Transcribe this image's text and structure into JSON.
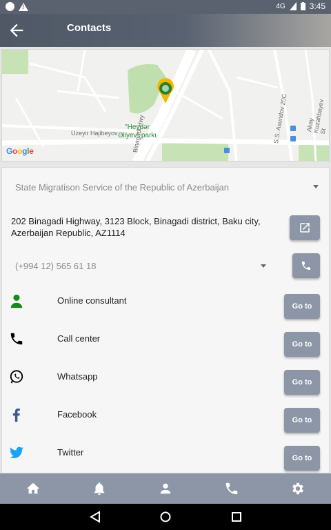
{
  "status_bar": {
    "signal": "4G",
    "time": "3:45"
  },
  "app_bar": {
    "title": "Contacts"
  },
  "map": {
    "park_label_line1": "\"Heydər",
    "park_label_line2": "Əliyev\" parkı",
    "street_1": "Uzeyir Hajibeyov",
    "street_2": "Binagadi Hwy",
    "street_3": "S.S. Axundov 20C",
    "street_4": "Akay Kuzahbayev St",
    "logo": "Google"
  },
  "organization": {
    "selected": "State Migratison Service of the Republic of Azerbaijan"
  },
  "address": {
    "text": "202 Binagadi Highway, 3123 Block, Binagadi district, Baku city, Azerbaijan Republic, AZ1114"
  },
  "phone": {
    "selected": "(+994 12) 565 61 18"
  },
  "channels": [
    {
      "label": "Online consultant",
      "button": "Go to",
      "icon": "person-icon",
      "color": "#1a8a1a"
    },
    {
      "label": "Call center",
      "button": "Go to",
      "icon": "phone-icon",
      "color": "#000000"
    },
    {
      "label": "Whatsapp",
      "button": "Go to",
      "icon": "whatsapp-icon",
      "color": "#000000"
    },
    {
      "label": "Facebook",
      "button": "Go to",
      "icon": "facebook-icon",
      "color": "#3b5998"
    },
    {
      "label": "Twitter",
      "button": "Go to",
      "icon": "twitter-icon",
      "color": "#1da1f2"
    }
  ],
  "bottom_nav": [
    "home-icon",
    "bell-icon",
    "profile-icon",
    "phone-icon",
    "settings-icon"
  ],
  "colors": {
    "accent": "#8c96a6",
    "appbar": "#58616e"
  }
}
